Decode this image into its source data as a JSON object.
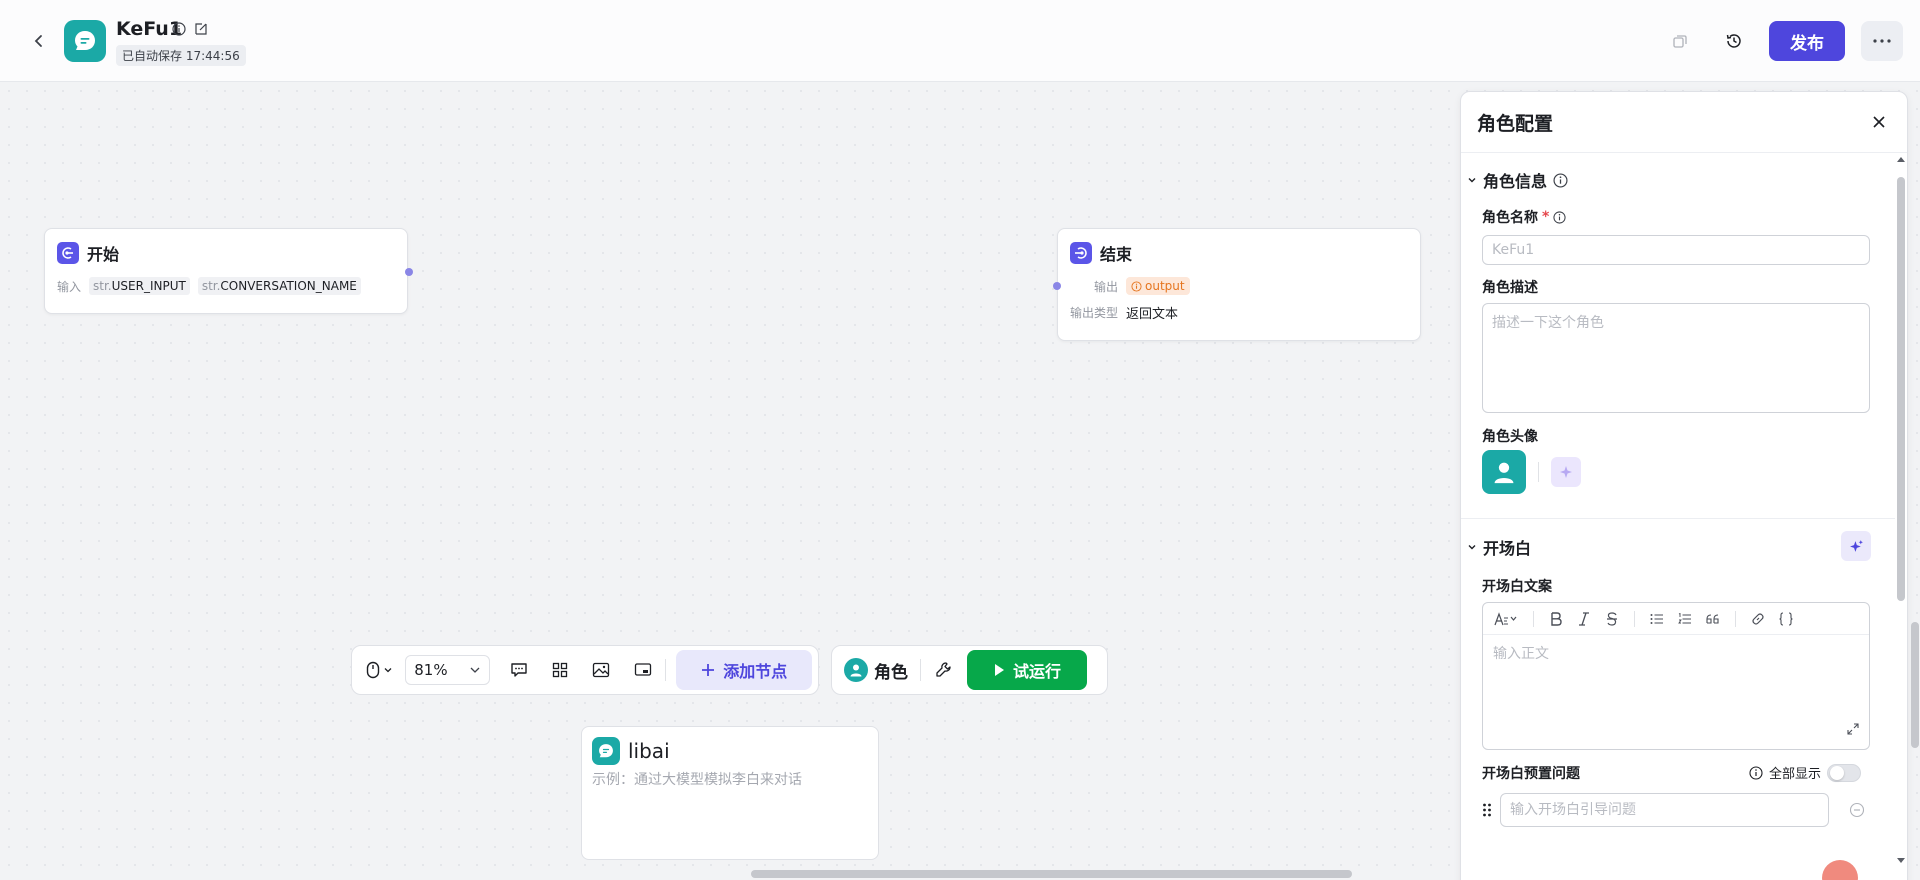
{
  "header": {
    "app_name": "KeFu1",
    "autosave": "已自动保存 17:44:56",
    "publish_label": "发布"
  },
  "nodes": {
    "start": {
      "title": "开始",
      "input_label": "输入",
      "inputs": [
        {
          "type": "str.",
          "name": "USER_INPUT"
        },
        {
          "type": "str.",
          "name": "CONVERSATION_NAME"
        }
      ]
    },
    "end": {
      "title": "结束",
      "output_label": "输出",
      "output_value": "output",
      "output_type_label": "输出类型",
      "output_type_value": "返回文本"
    },
    "libai": {
      "title": "libai",
      "description": "示例：通过大模型模拟李白来对话"
    }
  },
  "toolbar": {
    "zoom": "81%",
    "add_node_label": "添加节点",
    "role_label": "角色",
    "test_run_label": "试运行"
  },
  "panel": {
    "title": "角色配置",
    "role_info": {
      "section_title": "角色信息",
      "name_label": "角色名称",
      "name_required_mark": "*",
      "name_placeholder": "KeFu1",
      "desc_label": "角色描述",
      "desc_placeholder": "描述一下这个角色",
      "avatar_label": "角色头像"
    },
    "opening": {
      "section_title": "开场白",
      "text_label": "开场白文案",
      "editor_placeholder": "输入正文",
      "preset_label": "开场白预置问题",
      "show_all_label": "全部显示",
      "preset_placeholder": "输入开场白引导问题"
    }
  },
  "colors": {
    "brand": "#4e46dd",
    "teal": "#1ba9a6",
    "run_green": "#07a84a",
    "output_orange": "#e5751f"
  }
}
